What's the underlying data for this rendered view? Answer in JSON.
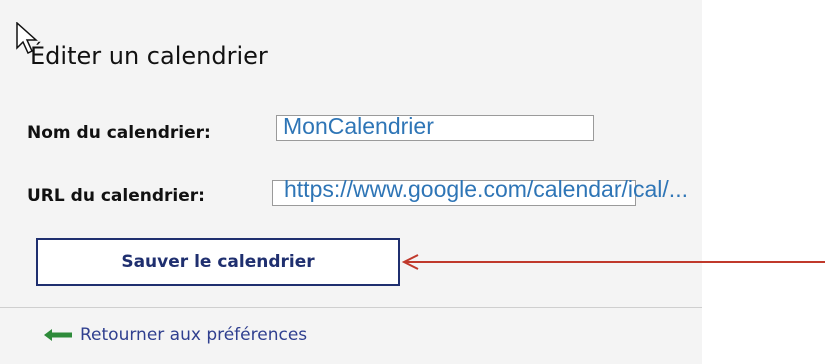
{
  "page": {
    "title": "Éditer un calendrier"
  },
  "form": {
    "name_label": "Nom du calendrier:",
    "name_value": "MonCalendrier",
    "url_label": "URL du calendrier:",
    "url_value": "https://www.google.com/calendar/ical/..."
  },
  "actions": {
    "save_label": "Sauver le calendrier",
    "back_label": "Retourner aux préférences"
  },
  "icons": {
    "cursor": "mouse-pointer-icon",
    "back": "arrow-left-icon",
    "annotation": "red-arrow-annotation"
  },
  "colors": {
    "accent": "#1f2f6f",
    "value_text": "#2e75b6",
    "back_arrow": "#2e8b3a",
    "annotation": "#c0392b"
  }
}
